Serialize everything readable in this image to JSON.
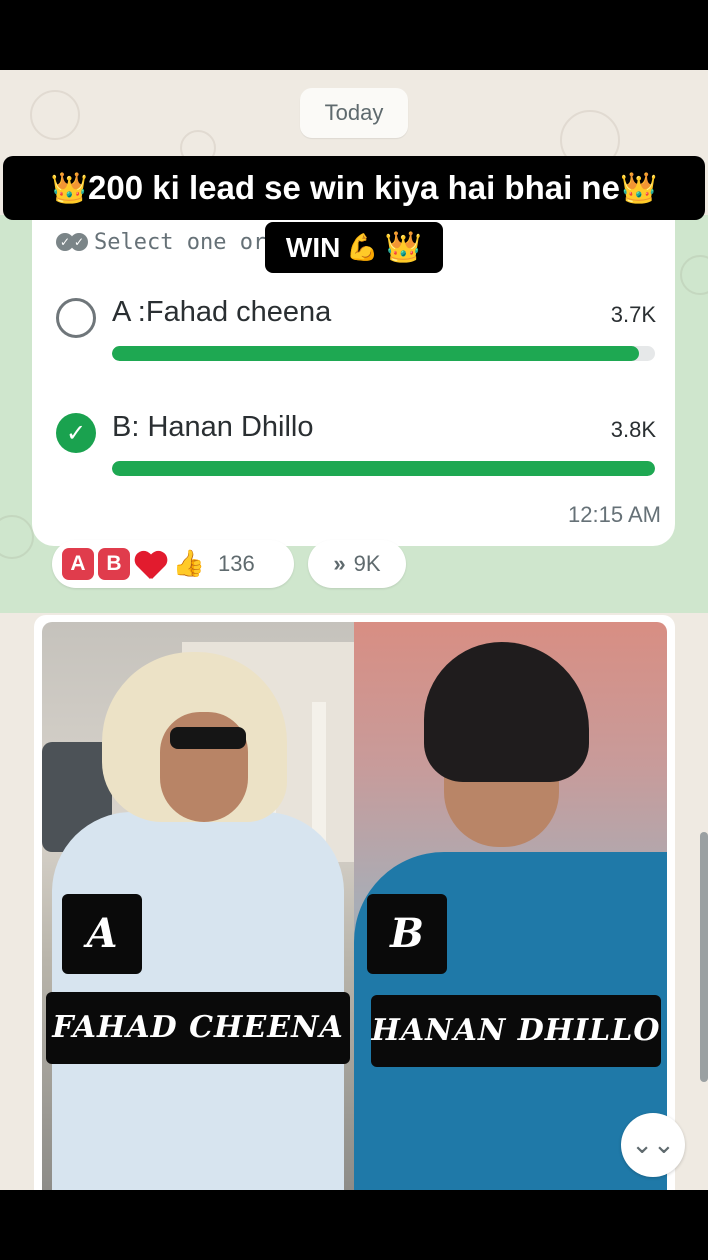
{
  "date_chip": "Today",
  "caption": {
    "text": "200 ki lead se win kiya hai bhai ne",
    "crown_icon": "👑"
  },
  "win_badge": {
    "text": "WIN",
    "arm_icon": "💪",
    "crown_icon": "👑"
  },
  "poll": {
    "select_hint": "Select one or",
    "options": [
      {
        "label": "A :Fahad cheena",
        "count": "3.7K",
        "fill": 0.97,
        "checked": false
      },
      {
        "label": "B: Hanan Dhillo",
        "count": "3.8K",
        "fill": 1.0,
        "checked": true
      }
    ],
    "time": "12:15 AM"
  },
  "reactions": {
    "a_letter": "A",
    "b_letter": "B",
    "thumb_icon": "👍",
    "count": "136"
  },
  "forward": {
    "icon": "»",
    "count": "9K"
  },
  "image": {
    "left": {
      "letter": "A",
      "name": "FAHAD CHEENA"
    },
    "right": {
      "letter": "B",
      "name": "HANAN DHILLO"
    }
  },
  "scroll_down_icon": "⌄⌄",
  "colors": {
    "accent_green": "#1ea852",
    "check_green": "#1aa24f",
    "selected_band": "#cfe6cd",
    "wallpaper": "#efeae2"
  }
}
